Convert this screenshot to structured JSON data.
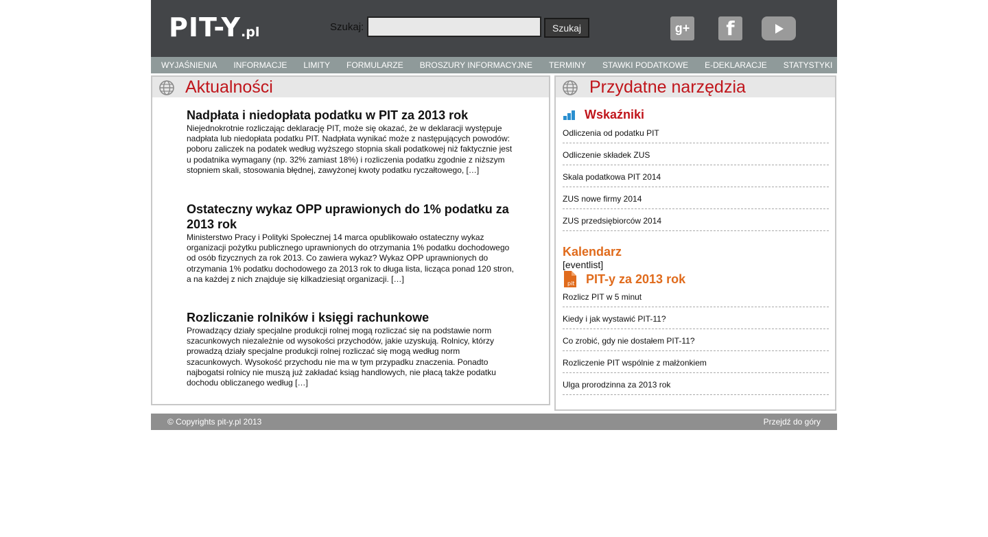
{
  "header": {
    "logo_main": "PIT-Y",
    "logo_suffix": ".pl",
    "search_label": "Szukaj:",
    "search_value": "",
    "search_button": "Szukaj",
    "social": [
      "google-plus-icon",
      "facebook-icon",
      "youtube-icon"
    ],
    "social_glyphs": {
      "google": "g+",
      "facebook": "f"
    }
  },
  "nav": [
    "WYJAŚNIENIA",
    "INFORMACJE",
    "LIMITY",
    "FORMULARZE",
    "BROSZURY INFORMACYJNE",
    "TERMINY",
    "STAWKI PODATKOWE",
    "E-DEKLARACJE",
    "STATYSTYKI"
  ],
  "news": {
    "title": "Aktualności",
    "articles": [
      {
        "title": "Nadpłata i niedopłata podatku w PIT za 2013 rok",
        "body": "Niejednokrotnie rozliczając deklarację PIT, może się okazać, że w deklaracji występuje nadpłata lub niedopłata podatku PIT. Nadpłata wynikać może z następujących powodów: poboru zaliczek na podatek według wyższego stopnia skali podatkowej niż faktycznie jest u podatnika wymagany (np. 32% zamiast 18%) i rozliczenia podatku zgodnie z niższym stopniem skali, stosowania błędnej, zawyżonej kwoty podatku ryczałtowego, […]"
      },
      {
        "title": "Ostateczny wykaz OPP uprawionych do 1% podatku za 2013 rok",
        "body": "Ministerstwo Pracy i Polityki Społecznej 14 marca opublikowało ostateczny wykaz organizacji pożytku publicznego uprawnionych do otrzymania 1% podatku dochodowego od osób fizycznych za rok 2013. Co zawiera wykaz? Wykaz OPP uprawnionych do otrzymania 1% podatku dochodowego za 2013 rok to długa lista, licząca ponad 120 stron, a na każdej z nich znajduje się kilkadziesiąt organizacji. […]"
      },
      {
        "title": "Rozliczanie rolników i księgi rachunkowe",
        "body": "Prowadzący działy specjalne produkcji rolnej mogą rozliczać się na podstawie norm szacunkowych niezależnie od wysokości przychodów, jakie uzyskują. Rolnicy, którzy prowadzą działy specjalne produkcji rolnej rozliczać się mogą według norm szacunkowych. Wysokość przychodu nie ma w tym przypadku znaczenia. Ponadto najbogatsi rolnicy nie muszą już zakładać ksiąg handlowych, nie płacą także podatku dochodu obliczanego według […]"
      }
    ]
  },
  "tools": {
    "title": "Przydatne narzędzia",
    "indicators_title": "Wskaźniki",
    "indicators": [
      "Odliczenia od podatku PIT",
      "Odliczenie składek ZUS",
      "Skala podatkowa PIT 2014",
      "ZUS nowe firmy 2014",
      "ZUS przedsiębiorców 2014"
    ],
    "calendar_title": "Kalendarz",
    "calendar_placeholder": "[eventlist]",
    "pit_title": "PIT-y za 2013 rok",
    "pit_icon_text": "pit",
    "pit_links": [
      "Rozlicz PIT w 5 minut",
      "Kiedy i jak wystawić PIT-11?",
      "Co zrobić, gdy nie dostałem PIT-11?",
      "Rozliczenie PIT wspólnie z małżonkiem",
      "Ulga prorodzinna za 2013 rok"
    ]
  },
  "footer": {
    "copyright": "© Copyrights pit-y.pl 2013",
    "back_to_top": "Przejdź do góry"
  },
  "colors": {
    "header_bg": "#434548",
    "nav_bg": "#8f9a9a",
    "title_red": "#c0151b",
    "title_orange": "#e06b1c",
    "footer_bg": "#8f8f8f",
    "icon_blue": "#2a8fd0"
  }
}
